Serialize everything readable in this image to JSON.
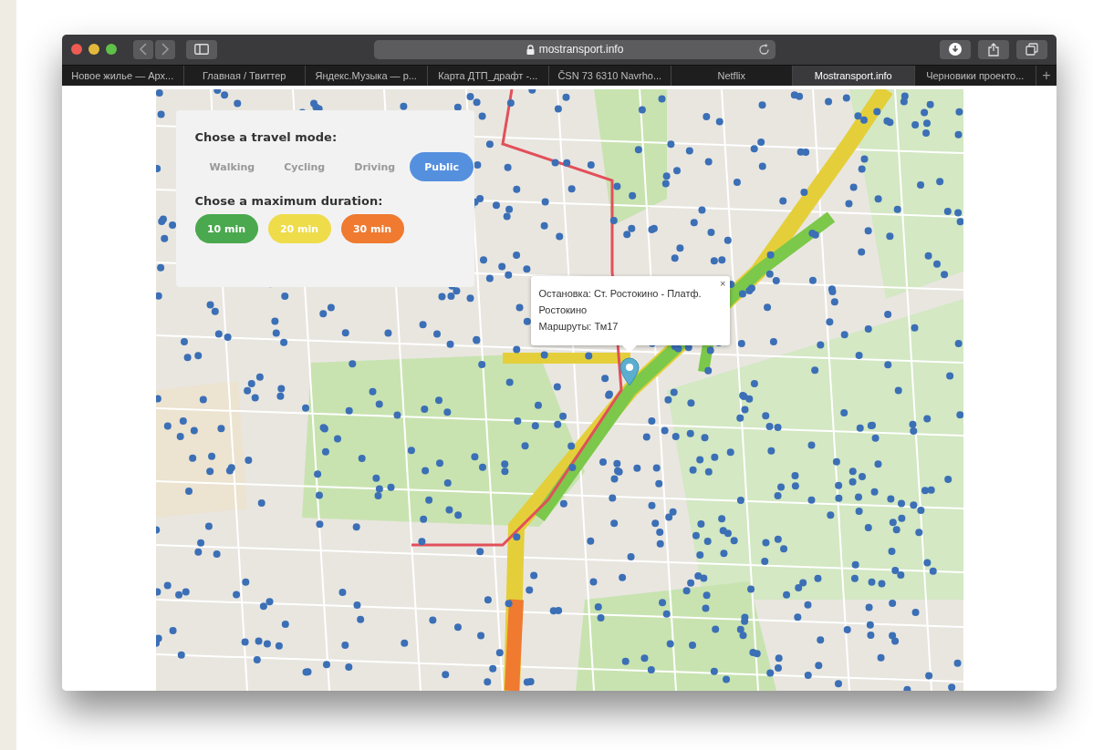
{
  "browser": {
    "address": "mostransport.info",
    "tabs": [
      {
        "label": "Новое жилье — Арх...",
        "selected": false
      },
      {
        "label": "Главная / Твиттер",
        "selected": false
      },
      {
        "label": "Яндекс.Музыка — р...",
        "selected": false
      },
      {
        "label": "Карта ДТП_драфт -...",
        "selected": false
      },
      {
        "label": "ČSN 73 6310 Navrho...",
        "selected": false
      },
      {
        "label": "Netflix",
        "selected": false
      },
      {
        "label": "Mostransport.info",
        "selected": true
      },
      {
        "label": "Черновики проекто...",
        "selected": false
      }
    ],
    "new_tab": "+"
  },
  "controls": {
    "travel_mode_title": "Chose a travel mode:",
    "modes": [
      {
        "label": "Walking",
        "selected": false
      },
      {
        "label": "Cycling",
        "selected": false
      },
      {
        "label": "Driving",
        "selected": false
      },
      {
        "label": "Public",
        "selected": true
      }
    ],
    "duration_title": "Chose a maximum duration:",
    "durations": [
      {
        "label": "10 min",
        "color": "#4aa84e"
      },
      {
        "label": "20 min",
        "color": "#eedc4a"
      },
      {
        "label": "30 min",
        "color": "#ef7a30"
      }
    ]
  },
  "popup": {
    "lines": [
      "Остановка: Ст. Ростокино - Платф. Ростокино",
      "Маршруты: Тм17"
    ],
    "close": "×"
  }
}
